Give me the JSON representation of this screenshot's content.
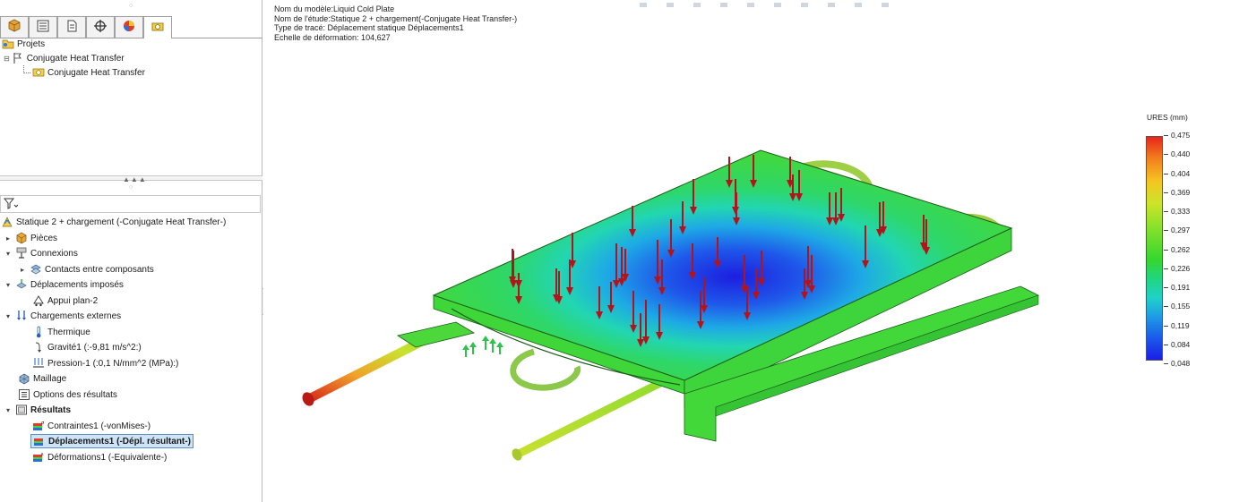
{
  "property_tree": {
    "root": "Projets",
    "study_group": "Conjugate Heat Transfer",
    "study": "Conjugate Heat Transfer"
  },
  "simulation_tree": {
    "study_title": "Statique 2 + chargement (-Conjugate Heat Transfer-)",
    "items": [
      {
        "label": "Pièces"
      },
      {
        "label": "Connexions"
      },
      {
        "label": "Contacts entre composants"
      },
      {
        "label": "Déplacements imposés"
      },
      {
        "label": "Appui plan-2"
      },
      {
        "label": "Chargements externes"
      },
      {
        "label": "Thermique"
      },
      {
        "label": "Gravité1 (:-9,81 m/s^2:)"
      },
      {
        "label": "Pression-1 (:0,1 N/mm^2 (MPa):)"
      },
      {
        "label": "Maillage"
      },
      {
        "label": "Options des résultats"
      },
      {
        "label": "Résultats"
      },
      {
        "label": "Contraintes1 (-vonMises-)"
      },
      {
        "label": "Déplacements1 (-Dépl. résultant-)"
      },
      {
        "label": "Déformations1 (-Equivalente-)"
      }
    ]
  },
  "viewport": {
    "info": {
      "model_name": "Nom du modèle:Liquid Cold Plate",
      "study_name": "Nom de l'étude:Statique 2 + chargement(-Conjugate Heat Transfer-)",
      "plot_type": "Type de tracé: Déplacement statique Déplacements1",
      "deformation_scale": "Echelle de déformation: 104,627"
    },
    "legend": {
      "title": "URES (mm)",
      "values": [
        "0,475",
        "0,440",
        "0,404",
        "0,369",
        "0,333",
        "0,297",
        "0,262",
        "0,226",
        "0,191",
        "0,155",
        "0,119",
        "0,084",
        "0,048"
      ],
      "max_color": "#e8261a",
      "min_color": "#1a1ee6"
    }
  },
  "colors": {
    "load_arrow": "#b3141c",
    "fixture_arrow": "#2fc24a",
    "plate_green": "#3fd83a"
  }
}
